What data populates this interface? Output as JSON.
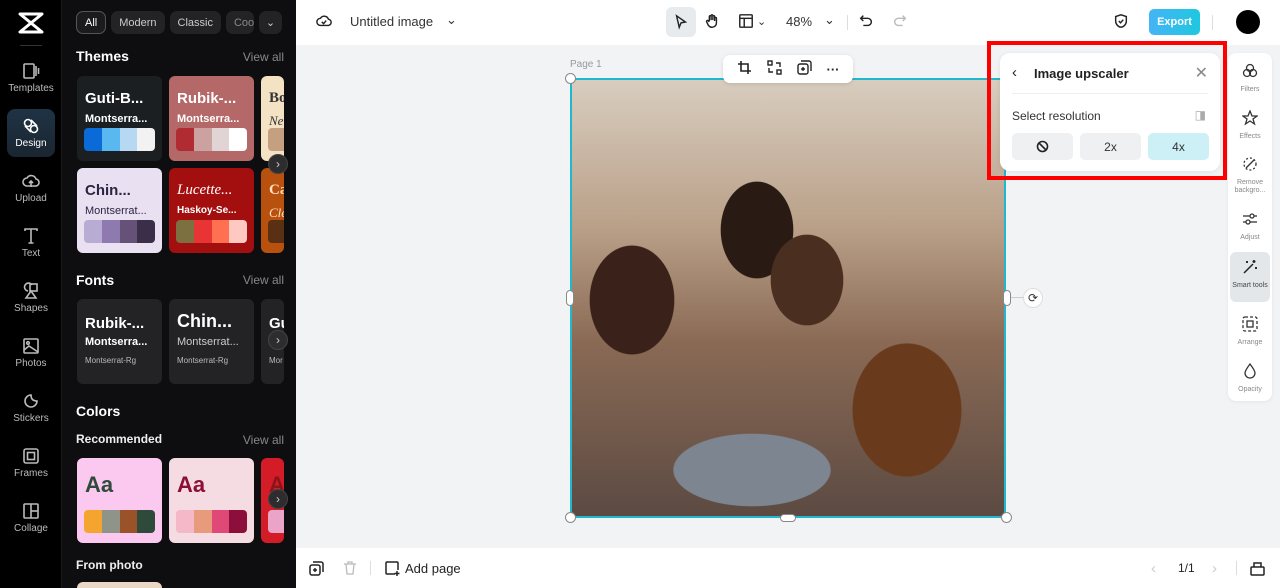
{
  "rail": {
    "items": [
      {
        "label": "Templates",
        "icon": "templates-icon"
      },
      {
        "label": "Design",
        "icon": "design-icon"
      },
      {
        "label": "Upload",
        "icon": "upload-icon"
      },
      {
        "label": "Text",
        "icon": "text-icon"
      },
      {
        "label": "Shapes",
        "icon": "shapes-icon"
      },
      {
        "label": "Photos",
        "icon": "photos-icon"
      },
      {
        "label": "Stickers",
        "icon": "stickers-icon"
      },
      {
        "label": "Frames",
        "icon": "frames-icon"
      },
      {
        "label": "Collage",
        "icon": "collage-icon"
      }
    ],
    "active": "Design"
  },
  "panel": {
    "chips": [
      "All",
      "Modern",
      "Classic",
      "Cool"
    ],
    "themes": {
      "title": "Themes",
      "view_all": "View all",
      "cards": [
        {
          "t1": "Guti-B...",
          "t2": "Montserra...",
          "bg": "#1c1f22",
          "fg": "#ffffff",
          "swatches": [
            "#0a6ad8",
            "#5ab8f0",
            "#b6d8f2",
            "#f2f2f2"
          ]
        },
        {
          "t1": "Rubik-...",
          "t2": "Montserra...",
          "bg": "#b46868",
          "fg": "#ffffff",
          "swatches": [
            "#b02c32",
            "#cca2a0",
            "#e0d4d4",
            "#ffffff"
          ]
        },
        {
          "t1": "Boo",
          "t2": "New",
          "bg": "#f3e2c4",
          "fg": "#333333",
          "swatches": [
            "#c4a080"
          ]
        },
        {
          "t1": "Chin...",
          "t2": "Montserrat...",
          "bg": "#e9e1f2",
          "fg": "#2c2540",
          "swatches": [
            "#b8acd4",
            "#8e7aae",
            "#665278",
            "#3a2e48"
          ]
        },
        {
          "t1": "Lucette...",
          "t2": "Haskoy-Se...",
          "bg": "#a30e0e",
          "fg": "#ffffff",
          "swatches": [
            "#7c7040",
            "#e83434",
            "#ff7050",
            "#ffc8c0"
          ]
        },
        {
          "t1": "Ca",
          "t2": "Cle",
          "bg": "#b8500e",
          "fg": "#ffe0c0",
          "swatches": [
            "#5a3014"
          ]
        }
      ]
    },
    "fonts": {
      "title": "Fonts",
      "view_all": "View all",
      "cards": [
        {
          "t1": "Rubik-...",
          "t2": "Montserra...",
          "t3": "Montserrat-Rg"
        },
        {
          "t1": "Chin...",
          "t2": "Montserrat...",
          "t3": "Montserrat-Rg"
        },
        {
          "t1": "Gu",
          "t2": "",
          "t3": "Mor"
        }
      ]
    },
    "colors": {
      "title": "Colors",
      "recommended": "Recommended",
      "view_all": "View all",
      "cards": [
        {
          "text": "Aa",
          "bg": "#fbc8f0",
          "fg": "#2e4a3a",
          "swatches": [
            "#f4a530",
            "#909488",
            "#9a5228",
            "#2e4a3a"
          ]
        },
        {
          "text": "Aa",
          "bg": "#f4dce2",
          "fg": "#8c0e3a",
          "swatches": [
            "#f4b8c8",
            "#e89a7c",
            "#e04878",
            "#8c0e3a"
          ]
        },
        {
          "text": "A",
          "bg": "#d41c28",
          "fg": "#8a1418",
          "swatches": [
            "#eaa4c8"
          ]
        }
      ],
      "from_photo": "From photo"
    }
  },
  "topbar": {
    "doc_title": "Untitled image",
    "zoom": "48%",
    "export_label": "Export"
  },
  "canvas": {
    "page_label": "Page 1"
  },
  "upscaler": {
    "title": "Image upscaler",
    "select_label": "Select resolution",
    "options": [
      "none",
      "2x",
      "4x"
    ],
    "selected": "4x"
  },
  "tools": [
    {
      "label": "Filters",
      "icon": "filters-icon"
    },
    {
      "label": "Effects",
      "icon": "effects-icon"
    },
    {
      "label": "Remove backgro...",
      "icon": "remove-background-icon"
    },
    {
      "label": "Adjust",
      "icon": "adjust-icon"
    },
    {
      "label": "Smart tools",
      "icon": "smart-tools-icon"
    },
    {
      "label": "Arrange",
      "icon": "arrange-icon"
    },
    {
      "label": "Opacity",
      "icon": "opacity-icon"
    }
  ],
  "bottombar": {
    "add_page": "Add page",
    "page_indicator": "1/1"
  }
}
